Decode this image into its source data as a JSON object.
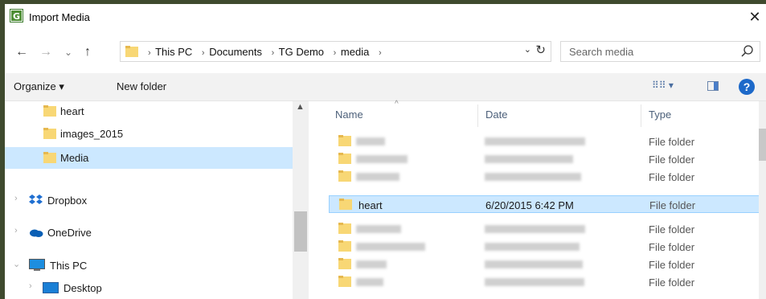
{
  "window": {
    "title": "Import Media",
    "close_glyph": "✕"
  },
  "nav": {
    "back_glyph": "←",
    "forward_glyph": "→",
    "recent_glyph": "⌄",
    "up_glyph": "↑",
    "breadcrumbs": [
      "This PC",
      "Documents",
      "TG Demo",
      "media"
    ],
    "separator": "›",
    "dropdown_glyph": "⌄",
    "refresh_glyph": "↻"
  },
  "search": {
    "placeholder": "Search media",
    "value": ""
  },
  "toolbar": {
    "organize_label": "Organize ▾",
    "new_folder_label": "New folder",
    "view_glyph": "⠿⠿ ▾",
    "help_glyph": "?"
  },
  "sidebar": {
    "items": [
      {
        "label": "heart",
        "icon": "folder-icon",
        "selected": false
      },
      {
        "label": "images_2015",
        "icon": "folder-icon",
        "selected": false
      },
      {
        "label": "Media",
        "icon": "folder-icon",
        "selected": true
      },
      {
        "label": "Dropbox",
        "icon": "dropbox-icon",
        "selected": false
      },
      {
        "label": "OneDrive",
        "icon": "onedrive-icon",
        "selected": false
      },
      {
        "label": "This PC",
        "icon": "computer-icon",
        "selected": false
      },
      {
        "label": "Desktop",
        "icon": "desktop-icon",
        "selected": false
      }
    ],
    "expand_glyph": "›",
    "expanded_glyph": "⌄",
    "scroll_up_glyph": "▲"
  },
  "list": {
    "columns": [
      "Name",
      "Date",
      "Type"
    ],
    "sort_glyph": "^",
    "rows": [
      {
        "name": "",
        "date": "",
        "type": "File folder"
      },
      {
        "name": "",
        "date": "",
        "type": "File folder"
      },
      {
        "name": "",
        "date": "",
        "type": "File folder"
      },
      {
        "name": "heart",
        "date": "6/20/2015 6:42 PM",
        "type": "File folder"
      },
      {
        "name": "",
        "date": "",
        "type": "File folder"
      },
      {
        "name": "",
        "date": "",
        "type": "File folder"
      },
      {
        "name": "",
        "date": "",
        "type": "File folder"
      },
      {
        "name": "",
        "date": "",
        "type": "File folder"
      }
    ]
  },
  "colors": {
    "selection": "#cce8ff",
    "folder": "#f8d775",
    "folder_dark": "#e6b84f",
    "accent": "#1d69c9"
  }
}
